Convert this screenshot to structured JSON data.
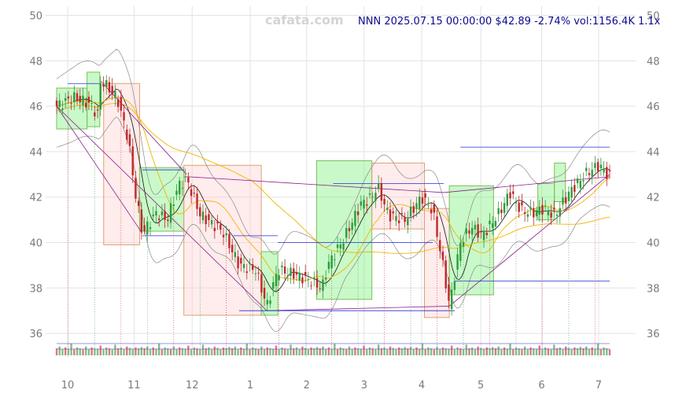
{
  "chart_data": {
    "type": "candlestick",
    "watermark": "cafata.com",
    "info": {
      "symbol": "NNN",
      "datetime": "2025.07.15 00:00:00",
      "price": "$42.89",
      "change": "-2.74%",
      "volume": "vol:1156.4K",
      "ratio": "1.1x"
    },
    "ylim": [
      35,
      50.4
    ],
    "y_ticks": [
      "36",
      "38",
      "40",
      "42",
      "44",
      "46",
      "48",
      "50"
    ],
    "x_ticks": [
      {
        "label": "10",
        "t": 0.02
      },
      {
        "label": "11",
        "t": 0.14
      },
      {
        "label": "12",
        "t": 0.245
      },
      {
        "label": "1",
        "t": 0.35
      },
      {
        "label": "2",
        "t": 0.452
      },
      {
        "label": "3",
        "t": 0.556
      },
      {
        "label": "4",
        "t": 0.66
      },
      {
        "label": "5",
        "t": 0.767
      },
      {
        "label": "6",
        "t": 0.877
      },
      {
        "label": "7",
        "t": 0.98
      }
    ],
    "price_path": [
      [
        0.0,
        46.0
      ],
      [
        0.03,
        46.4
      ],
      [
        0.06,
        46.1
      ],
      [
        0.075,
        45.6
      ],
      [
        0.08,
        47.2
      ],
      [
        0.11,
        46.3
      ],
      [
        0.13,
        44.5
      ],
      [
        0.14,
        42.5
      ],
      [
        0.155,
        40.4
      ],
      [
        0.18,
        41.3
      ],
      [
        0.2,
        41.0
      ],
      [
        0.22,
        42.5
      ],
      [
        0.235,
        42.8
      ],
      [
        0.26,
        41.2
      ],
      [
        0.3,
        40.5
      ],
      [
        0.33,
        39.0
      ],
      [
        0.36,
        38.8
      ],
      [
        0.38,
        37.2
      ],
      [
        0.4,
        38.8
      ],
      [
        0.43,
        38.6
      ],
      [
        0.46,
        38.3
      ],
      [
        0.48,
        38.0
      ],
      [
        0.49,
        39.0
      ],
      [
        0.52,
        40.2
      ],
      [
        0.55,
        41.7
      ],
      [
        0.57,
        42.0
      ],
      [
        0.58,
        42.5
      ],
      [
        0.6,
        41.2
      ],
      [
        0.63,
        41.0
      ],
      [
        0.66,
        42.0
      ],
      [
        0.68,
        41.4
      ],
      [
        0.7,
        38.8
      ],
      [
        0.71,
        37.2
      ],
      [
        0.73,
        40.0
      ],
      [
        0.75,
        40.7
      ],
      [
        0.77,
        40.3
      ],
      [
        0.8,
        41.3
      ],
      [
        0.82,
        42.2
      ],
      [
        0.84,
        41.4
      ],
      [
        0.86,
        41.3
      ],
      [
        0.88,
        41.5
      ],
      [
        0.9,
        41.2
      ],
      [
        0.93,
        42.3
      ],
      [
        0.96,
        43.1
      ],
      [
        0.98,
        43.4
      ],
      [
        1.0,
        42.9
      ]
    ],
    "boxes": [
      {
        "t0": 0.0,
        "t1": 0.055,
        "low": 45.0,
        "high": 46.8,
        "kind": "up"
      },
      {
        "t0": 0.055,
        "t1": 0.078,
        "low": 45.1,
        "high": 47.5,
        "kind": "up"
      },
      {
        "t0": 0.085,
        "t1": 0.15,
        "low": 39.9,
        "high": 47.0,
        "kind": "down"
      },
      {
        "t0": 0.15,
        "t1": 0.23,
        "low": 40.5,
        "high": 43.3,
        "kind": "up"
      },
      {
        "t0": 0.23,
        "t1": 0.37,
        "low": 36.8,
        "high": 43.4,
        "kind": "down"
      },
      {
        "t0": 0.37,
        "t1": 0.4,
        "low": 36.8,
        "high": 39.6,
        "kind": "up"
      },
      {
        "t0": 0.47,
        "t1": 0.57,
        "low": 37.5,
        "high": 43.6,
        "kind": "up"
      },
      {
        "t0": 0.57,
        "t1": 0.665,
        "low": 40.6,
        "high": 43.5,
        "kind": "down"
      },
      {
        "t0": 0.665,
        "t1": 0.71,
        "low": 36.7,
        "high": 41.5,
        "kind": "down"
      },
      {
        "t0": 0.71,
        "t1": 0.79,
        "low": 37.7,
        "high": 42.5,
        "kind": "up"
      },
      {
        "t0": 0.87,
        "t1": 0.9,
        "low": 41.0,
        "high": 42.6,
        "kind": "up"
      },
      {
        "t0": 0.9,
        "t1": 0.92,
        "low": 41.8,
        "high": 43.5,
        "kind": "up"
      }
    ],
    "hlines": [
      [
        0.02,
        0.08,
        47.0
      ],
      [
        0.155,
        0.23,
        43.2
      ],
      [
        0.155,
        0.23,
        40.3
      ],
      [
        0.32,
        0.4,
        40.3
      ],
      [
        0.4,
        0.68,
        40.0
      ],
      [
        0.33,
        0.72,
        37.0
      ],
      [
        0.5,
        0.7,
        42.6
      ],
      [
        0.73,
        1.0,
        44.2
      ],
      [
        0.72,
        1.0,
        38.3
      ]
    ],
    "volume_levels": [
      0.4,
      0.6,
      0.3,
      0.5,
      0.35,
      0.9,
      0.3,
      0.5,
      0.4,
      0.3,
      0.6,
      0.3,
      0.5,
      0.4,
      0.35,
      0.7,
      0.3,
      0.5,
      0.4,
      0.3,
      0.8,
      0.4,
      0.5,
      0.3,
      0.6,
      0.45,
      0.3,
      0.5,
      0.4,
      0.55
    ]
  }
}
